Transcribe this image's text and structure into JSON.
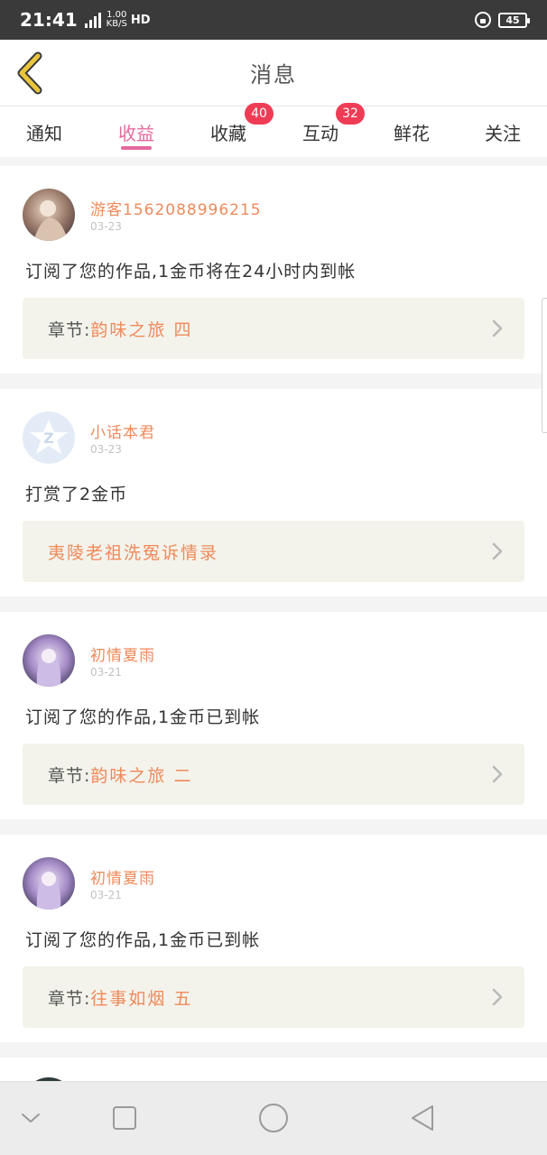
{
  "status_bar": {
    "time": "21:41",
    "network": "4G",
    "speed_value": "1.00",
    "speed_unit": "KB/S",
    "hd": "HD",
    "battery": "45"
  },
  "header": {
    "title": "消息"
  },
  "tabs": [
    {
      "label": "通知",
      "badge": null,
      "active": false
    },
    {
      "label": "收益",
      "badge": null,
      "active": true
    },
    {
      "label": "收藏",
      "badge": "40",
      "active": false
    },
    {
      "label": "互动",
      "badge": "32",
      "active": false
    },
    {
      "label": "鲜花",
      "badge": null,
      "active": false
    },
    {
      "label": "关注",
      "badge": null,
      "active": false
    }
  ],
  "messages": [
    {
      "username": "游客1562088996215",
      "date": "03-23",
      "text": "订阅了您的作品,1金币将在24小时内到帐",
      "chapter_prefix": "章节:",
      "chapter_title": "韵味之旅 四"
    },
    {
      "username": "小话本君",
      "date": "03-23",
      "text": "打赏了2金币",
      "chapter_prefix": "",
      "chapter_title": "夷陵老祖洗冤诉情录"
    },
    {
      "username": "初情夏雨",
      "date": "03-21",
      "text": "订阅了您的作品,1金币已到帐",
      "chapter_prefix": "章节:",
      "chapter_title": "韵味之旅 二"
    },
    {
      "username": "初情夏雨",
      "date": "03-21",
      "text": "订阅了您的作品,1金币已到帐",
      "chapter_prefix": "章节:",
      "chapter_title": "往事如烟 五"
    }
  ],
  "colors": {
    "accent_pink": "#e5689e",
    "accent_orange": "#ef8a5a",
    "badge_red": "#ef3c55",
    "back_arrow": "#e9c53c",
    "chapter_bg": "#f3f3ec"
  }
}
